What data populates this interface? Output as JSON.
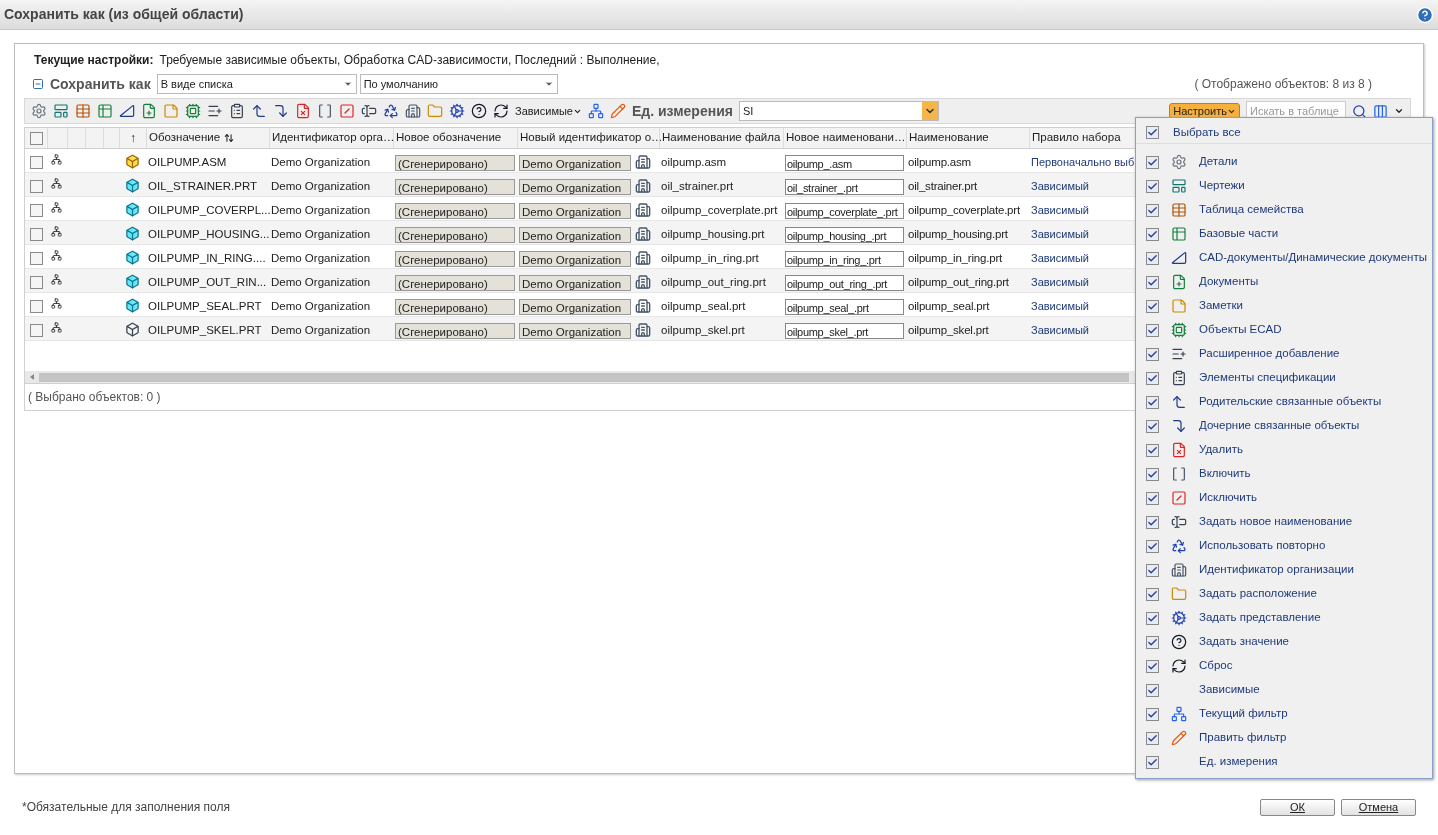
{
  "window": {
    "title": "Сохранить как (из общей области)"
  },
  "settings": {
    "label": "Текущие настройки:",
    "value": "Требуемые зависимые объекты, Обработка CAD-зависимости, Последний : Выполнение,"
  },
  "save_as": {
    "expanded": true,
    "label": "Сохранить как",
    "view_select": "В виде списка",
    "preset_select": "По умолчанию",
    "shown_count": "( Отображено объектов: 8 из 8 )"
  },
  "toolbar": {
    "dependents_button": "Зависимые",
    "units_label": "Ед. измерения",
    "units_value": "SI",
    "configure_button": "Настроить",
    "search_placeholder": "Искать в таблице"
  },
  "table": {
    "select_all_checked": false,
    "sort_column_header": "↑",
    "columns": [
      "Обозначение",
      "Идентификатор орга…",
      "Новое обозначение",
      "Новый идентификатор о…",
      "Наименование файла",
      "Новое наименовани…",
      "Наименование",
      "Правило набора"
    ],
    "rows": [
      {
        "checked": false,
        "kind": "assembly",
        "number": "OILPUMP.ASM",
        "org": "Demo Organization",
        "new_number": "(Сгенерировано)",
        "new_org": "Demo Organization",
        "file": "oilpump.asm",
        "new_file": "oilpump_.asm",
        "name": "oilpump.asm",
        "rule": "Первоначально выб"
      },
      {
        "checked": false,
        "kind": "part",
        "number": "OIL_STRAINER.PRT",
        "org": "Demo Organization",
        "new_number": "(Сгенерировано)",
        "new_org": "Demo Organization",
        "file": "oil_strainer.prt",
        "new_file": "oil_strainer_.prt",
        "name": "oil_strainer.prt",
        "rule": "Зависимый"
      },
      {
        "checked": false,
        "kind": "part",
        "number": "OILPUMP_COVERPL...",
        "org": "Demo Organization",
        "new_number": "(Сгенерировано)",
        "new_org": "Demo Organization",
        "file": "oilpump_coverplate.prt",
        "new_file": "oilpump_coverplate_.prt",
        "name": "oilpump_coverplate.prt",
        "rule": "Зависимый"
      },
      {
        "checked": false,
        "kind": "part",
        "number": "OILPUMP_HOUSING...",
        "org": "Demo Organization",
        "new_number": "(Сгенерировано)",
        "new_org": "Demo Organization",
        "file": "oilpump_housing.prt",
        "new_file": "oilpump_housing_.prt",
        "name": "oilpump_housing.prt",
        "rule": "Зависимый"
      },
      {
        "checked": false,
        "kind": "part",
        "number": "OILPUMP_IN_RING....",
        "org": "Demo Organization",
        "new_number": "(Сгенерировано)",
        "new_org": "Demo Organization",
        "file": "oilpump_in_ring.prt",
        "new_file": "oilpump_in_ring_.prt",
        "name": "oilpump_in_ring.prt",
        "rule": "Зависимый"
      },
      {
        "checked": false,
        "kind": "part",
        "number": "OILPUMP_OUT_RIN...",
        "org": "Demo Organization",
        "new_number": "(Сгенерировано)",
        "new_org": "Demo Organization",
        "file": "oilpump_out_ring.prt",
        "new_file": "oilpump_out_ring_.prt",
        "name": "oilpump_out_ring.prt",
        "rule": "Зависимый"
      },
      {
        "checked": false,
        "kind": "part",
        "number": "OILPUMP_SEAL.PRT",
        "org": "Demo Organization",
        "new_number": "(Сгенерировано)",
        "new_org": "Demo Organization",
        "file": "oilpump_seal.prt",
        "new_file": "oilpump_seal_.prt",
        "name": "oilpump_seal.prt",
        "rule": "Зависимый"
      },
      {
        "checked": false,
        "kind": "skeleton",
        "number": "OILPUMP_SKEL.PRT",
        "org": "Demo Organization",
        "new_number": "(Сгенерировано)",
        "new_org": "Demo Organization",
        "file": "oilpump_skel.prt",
        "new_file": "oilpump_skel_.prt",
        "name": "oilpump_skel.prt",
        "rule": "Зависимый"
      }
    ],
    "selected_count": "( Выбрано объектов: 0 )"
  },
  "configure_menu": {
    "select_all": {
      "label": "Выбрать все",
      "checked": true
    },
    "items": [
      {
        "label": "Детали",
        "kind": "icon",
        "checked": true
      },
      {
        "label": "Чертежи",
        "kind": "icon",
        "checked": true
      },
      {
        "label": "Таблица семейства",
        "kind": "icon",
        "checked": true
      },
      {
        "label": "Базовые части",
        "kind": "icon",
        "checked": true
      },
      {
        "label": "CAD-документы/Динамические документы",
        "kind": "icon",
        "checked": true
      },
      {
        "label": "Документы",
        "kind": "icon",
        "checked": true
      },
      {
        "label": "Заметки",
        "kind": "icon",
        "checked": true
      },
      {
        "label": "Объекты ECAD",
        "kind": "icon",
        "checked": true
      },
      {
        "label": "Расширенное добавление",
        "kind": "icon",
        "checked": true
      },
      {
        "label": "Элементы спецификации",
        "kind": "icon",
        "checked": true
      },
      {
        "label": "Родительские связанные объекты",
        "kind": "icon",
        "checked": true
      },
      {
        "label": "Дочерние связанные объекты",
        "kind": "icon",
        "checked": true
      },
      {
        "label": "Удалить",
        "kind": "icon",
        "checked": true
      },
      {
        "label": "Включить",
        "kind": "icon",
        "checked": true
      },
      {
        "label": "Исключить",
        "kind": "icon",
        "checked": true
      },
      {
        "label": "Задать новое наименование",
        "kind": "icon",
        "checked": true
      },
      {
        "label": "Использовать повторно",
        "kind": "icon",
        "checked": true
      },
      {
        "label": "Идентификатор организации",
        "kind": "icon",
        "checked": true
      },
      {
        "label": "Задать расположение",
        "kind": "icon",
        "checked": true
      },
      {
        "label": "Задать представление",
        "kind": "icon",
        "checked": true
      },
      {
        "label": "Задать значение",
        "kind": "icon",
        "checked": true
      },
      {
        "label": "Сброс",
        "kind": "icon",
        "checked": true
      },
      {
        "label": "Зависимые",
        "kind": "text",
        "checked": true
      },
      {
        "label": "Текущий фильтр",
        "kind": "icon",
        "checked": true
      },
      {
        "label": "Править фильтр",
        "kind": "icon",
        "checked": true
      },
      {
        "label": "Ед. измерения",
        "kind": "text",
        "checked": true
      }
    ]
  },
  "footer": {
    "required_note": "*Обязательные для заполнения поля",
    "buttons": [
      "ОК",
      "Отмена"
    ]
  }
}
